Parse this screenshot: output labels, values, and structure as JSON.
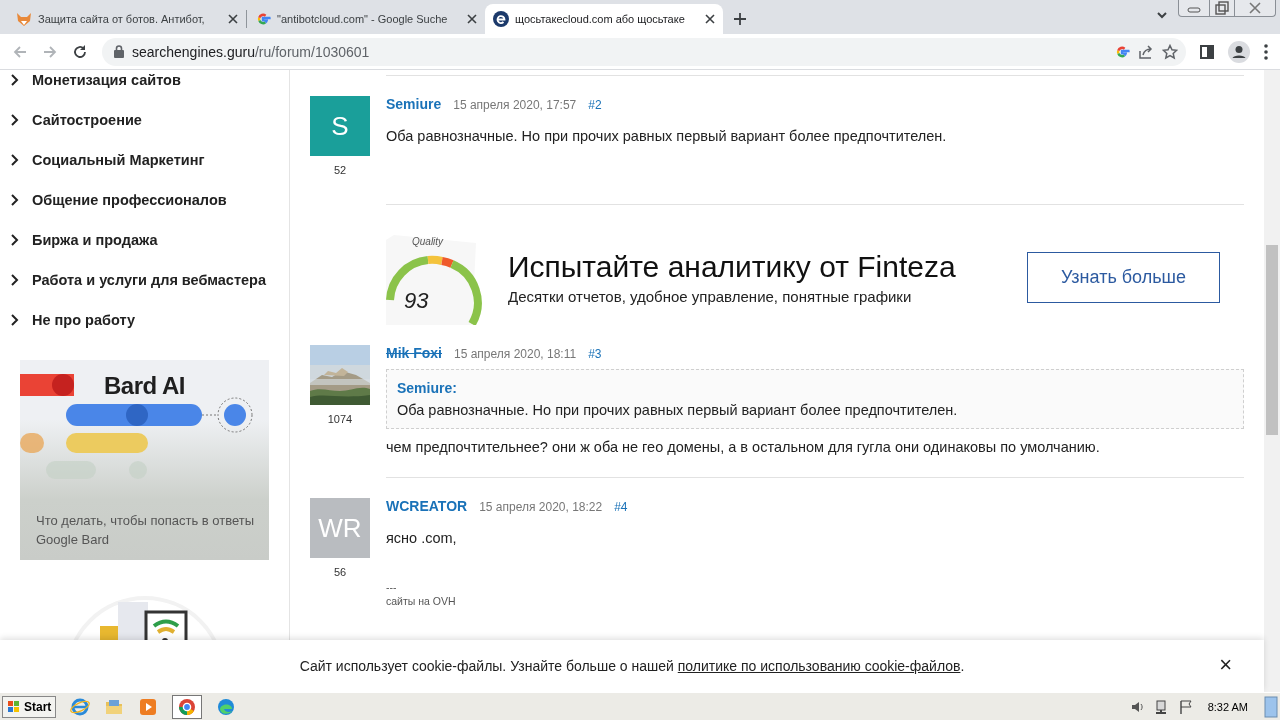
{
  "browser": {
    "tabs": [
      {
        "title": "Защита сайта от ботов. Антибот,",
        "kind": "fox",
        "selected": false
      },
      {
        "title": "\"antibotcloud.com\" - Google Suche",
        "kind": "google",
        "selected": false
      },
      {
        "title": "щосьтакеcloud.com або щосьтаке",
        "kind": "e",
        "selected": true
      }
    ],
    "address": {
      "domain": "searchengines.guru",
      "path": "/ru/forum/1030601"
    }
  },
  "sidebar": {
    "items": [
      "Монетизация сайтов",
      "Сайтостроение",
      "Социальный Маркетинг",
      "Общение профессионалов",
      "Биржа и продажа",
      "Работа и услуги для вебмастера",
      "Не про работу"
    ],
    "promo": {
      "title": "Bard AI",
      "caption": "Что делать, чтобы попасть в ответы Google Bard"
    }
  },
  "posts": [
    {
      "author": "Semiure",
      "struck": false,
      "date": "15 апреля 2020, 17:57",
      "number": "#2",
      "avatar": {
        "kind": "letter",
        "text": "S",
        "color": "#1a9f9a"
      },
      "count": "52",
      "body": "Оба равнозначные. Но при прочих равных первый вариант более предпочтителен."
    },
    {
      "author": "Mik Foxi",
      "struck": true,
      "date": "15 апреля 2020, 18:11",
      "number": "#3",
      "count": "1074",
      "quote": {
        "author": "Semiure:",
        "text": "Оба равнозначные. Но при прочих равных первый вариант более предпочтителен."
      },
      "body": "чем предпочтительнее? они ж оба не гео домены, а в остальном для гугла они одинаковы по умолчанию."
    },
    {
      "author": "WCREATOR",
      "struck": false,
      "date": "15 апреля 2020, 18:22",
      "number": "#4",
      "avatar": {
        "kind": "letter",
        "text": "WR",
        "color": "#b9bcc0"
      },
      "count": "56",
      "body": "ясно .com,",
      "signature": [
        "---",
        "сайты на OVH"
      ]
    }
  ],
  "banner": {
    "gauge_label": "Quality",
    "gauge_value": "93",
    "title": "Испытайте аналитику от Finteza",
    "subtitle": "Десятки отчетов, удобное управление, понятные графики",
    "button": "Узнать больше"
  },
  "cookie": {
    "text": "Сайт использует cookie-файлы. Узнайте больше о нашей ",
    "link": "политике по использованию cookie-файлов",
    "end": ".",
    "close": "×"
  },
  "taskbar": {
    "start": "Start",
    "clock": "8:32 AM"
  }
}
